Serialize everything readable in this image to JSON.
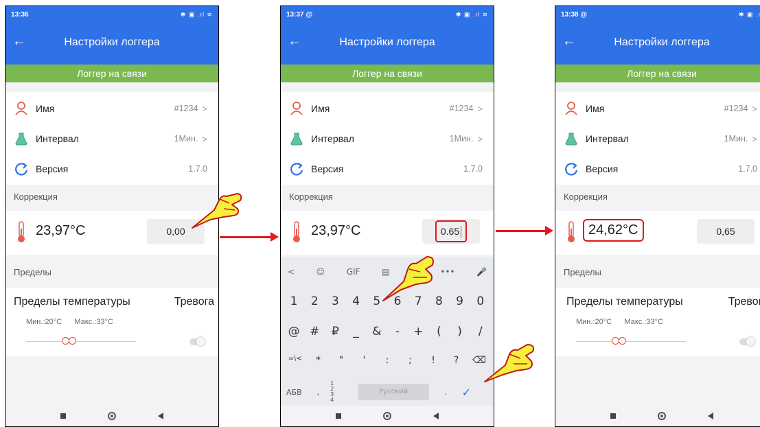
{
  "colors": {
    "appbar": "#2f71e6",
    "status_green": "#79b94f",
    "highlight_red": "#e01818"
  },
  "screens": [
    {
      "status_time": "13:36",
      "title": "Настройки логгера",
      "connection": "Логгер на связи",
      "name_label": "Имя",
      "name_value": "#1234",
      "interval_label": "Интервал",
      "interval_value": "1Мин.",
      "version_label": "Версия",
      "version_value": "1.7.0",
      "correction_title": "Коррекция",
      "temperature": "23,97°C",
      "correction_value": "0,00",
      "limits_title": "Пределы",
      "temp_limits_label": "Пределы температуры",
      "alarm_label": "Тревога",
      "min_label": "Мин.:20°C",
      "max_label": "Макс.:33°C"
    },
    {
      "status_time": "13:37 @",
      "title": "Настройки логгера",
      "connection": "Логгер на связи",
      "name_label": "Имя",
      "name_value": "#1234",
      "interval_label": "Интервал",
      "interval_value": "1Мин.",
      "version_label": "Версия",
      "version_value": "1.7.0",
      "correction_title": "Коррекция",
      "temperature": "23,97°C",
      "correction_value": "0.65",
      "keyboard": {
        "tools": [
          "<",
          "☺",
          "GIF",
          "▤",
          "⚙",
          "•••",
          "🎤"
        ],
        "row1": [
          "1",
          "2",
          "3",
          "4",
          "5",
          "6",
          "7",
          "8",
          "9",
          "0"
        ],
        "row2": [
          "@",
          "#",
          "₽",
          "_",
          "&",
          "-",
          "+",
          "(",
          ")",
          "/"
        ],
        "row3": [
          "=\\<",
          "*",
          "\"",
          "'",
          ":",
          ";",
          "!",
          "?",
          "⌫"
        ],
        "abc": "АБВ",
        "comma": ",",
        "num": "1 2 3 4",
        "space": "Русский",
        "dot": ".",
        "done": "✓"
      }
    },
    {
      "status_time": "13:38 @",
      "title": "Настройки логгера",
      "connection": "Логгер на связи",
      "name_label": "Имя",
      "name_value": "#1234",
      "interval_label": "Интервал",
      "interval_value": "1Мин.",
      "version_label": "Версия",
      "version_value": "1.7.0",
      "correction_title": "Коррекция",
      "temperature": "24,62°C",
      "correction_value": "0,65",
      "limits_title": "Пределы",
      "temp_limits_label": "Пределы температуры",
      "alarm_label": "Тревога",
      "min_label": "Мин.:20°C",
      "max_label": "Макс.:33°C"
    }
  ]
}
